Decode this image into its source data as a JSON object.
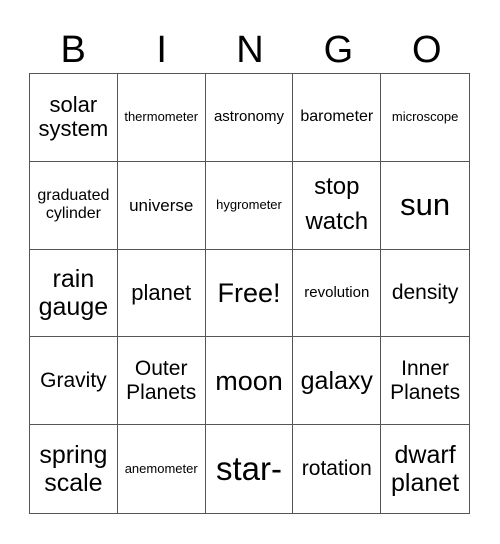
{
  "header": [
    "B",
    "I",
    "N",
    "G",
    "O"
  ],
  "cells": [
    "solar system",
    "thermometer",
    "astronomy",
    "barometer",
    "microscope",
    "graduated cylinder",
    "universe",
    "hygrometer",
    "stop watch",
    "sun",
    "rain gauge",
    "planet",
    "Free!",
    "revolution",
    "density",
    "Gravity",
    "Outer Planets",
    "moon",
    "galaxy",
    "Inner Planets",
    "spring scale",
    "anemometer",
    "star-",
    "rotation",
    "dwarf planet"
  ]
}
